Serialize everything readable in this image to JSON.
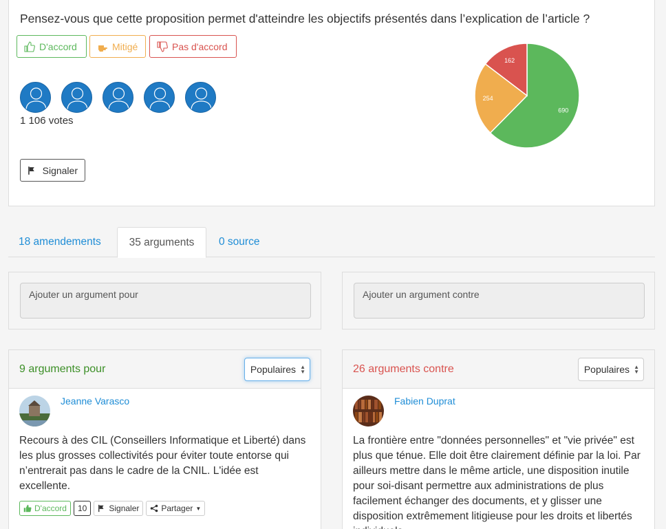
{
  "vote": {
    "question": "Pensez-vous que cette proposition permet d'atteindre les objectifs présentés dans l’explication de l’article ?",
    "buttons": {
      "agree": "D'accord",
      "mixed": "Mitigé",
      "disagree": "Pas d'accord"
    },
    "votes_label": "1 106 votes",
    "report_label": "Signaler"
  },
  "chart_data": {
    "type": "pie",
    "slices": [
      {
        "label": "690",
        "value": 690,
        "color": "#5cb85c"
      },
      {
        "label": "254",
        "value": 254,
        "color": "#f0ad4e"
      },
      {
        "label": "162",
        "value": 162,
        "color": "#d9534f"
      }
    ]
  },
  "tabs": [
    {
      "label": "18 amendements"
    },
    {
      "label": "35 arguments"
    },
    {
      "label": "0 source"
    }
  ],
  "add": {
    "pro_placeholder": "Ajouter un argument pour",
    "con_placeholder": "Ajouter un argument contre"
  },
  "pro": {
    "title": "9 arguments pour",
    "sort": "Populaires",
    "argument": {
      "author": "Jeanne Varasco",
      "text": "Recours à des CIL (Conseillers Informatique et Liberté) dans les plus grosses collectivités pour éviter toute entorse qui n’entrerait pas dans le cadre de la CNIL. L'idée est excellente.",
      "agree_label": "D'accord",
      "count": "10",
      "report_label": "Signaler",
      "share_label": "Partager"
    }
  },
  "con": {
    "title": "26 arguments contre",
    "sort": "Populaires",
    "argument": {
      "author": "Fabien Duprat",
      "text": "La frontière entre \"données personnelles\" et \"vie privée\" est plus que ténue. Elle doit être clairement définie par la loi. Par ailleurs mettre dans le même article, une disposition inutile pour soi-disant permettre aux administrations de plus facilement échanger des documents, et y glisser une disposition extrêmement litigieuse pour les droits et libertés individuels"
    }
  },
  "colors": {
    "primary": "#1f8dd6",
    "success": "#5cb85c",
    "warning": "#f0ad4e",
    "danger": "#d9534f"
  }
}
